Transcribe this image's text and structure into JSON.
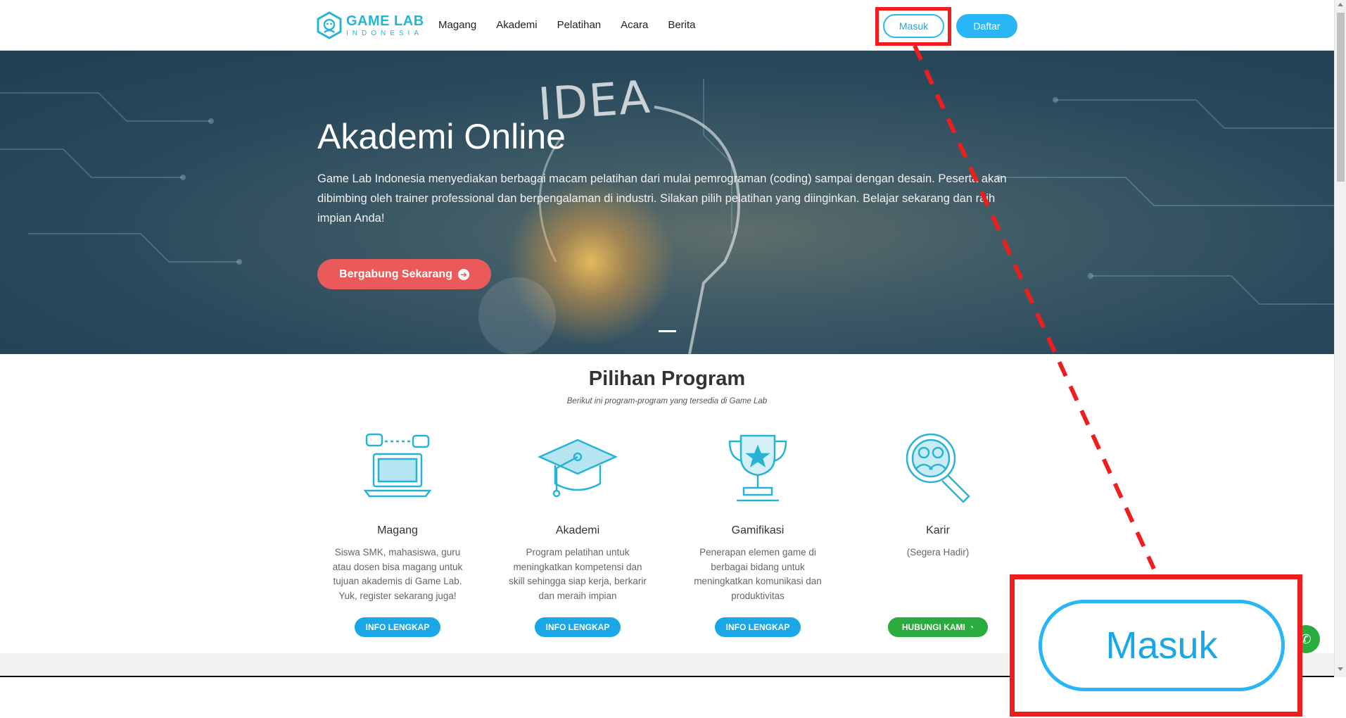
{
  "brand": {
    "name": "GAME LAB",
    "sub": "INDONESIA"
  },
  "nav": {
    "items": [
      "Magang",
      "Akademi",
      "Pelatihan",
      "Acara",
      "Berita"
    ],
    "login_label": "Masuk",
    "register_label": "Daftar"
  },
  "hero": {
    "title": "Akademi Online",
    "description": "Game Lab Indonesia menyediakan berbagai macam pelatihan dari mulai pemrograman (coding) sampai dengan desain. Peserta akan dibimbing oleh trainer professional dan berpengalaman di industri. Silakan pilih pelatihan yang diinginkan. Belajar sekarang dan raih impian Anda!",
    "cta_label": "Bergabung Sekarang",
    "background_text": "IDEA"
  },
  "programs": {
    "title": "Pilihan Program",
    "subtitle": "Berikut ini program-program yang tersedia di Game Lab",
    "cards": [
      {
        "title": "Magang",
        "desc": "Siswa SMK, mahasiswa, guru atau dosen bisa magang untuk tujuan akademis di Game Lab. Yuk, register sekarang juga!",
        "button": "INFO LENGKAP",
        "icon": "laptop-icon"
      },
      {
        "title": "Akademi",
        "desc": "Program pelatihan untuk meningkatkan kompetensi dan skill sehingga siap kerja, berkarir dan meraih impian",
        "button": "INFO LENGKAP",
        "icon": "graduation-cap-icon"
      },
      {
        "title": "Gamifikasi",
        "desc": "Penerapan elemen game di berbagai bidang untuk meningkatkan komunikasi dan produktivitas",
        "button": "INFO LENGKAP",
        "icon": "trophy-icon"
      },
      {
        "title": "Karir",
        "desc": "(Segera Hadir)",
        "button": "HUBUNGI KAMI",
        "icon": "magnifier-people-icon"
      }
    ]
  },
  "zoom": {
    "label": "Masuk"
  },
  "colors": {
    "accent": "#29b6f6",
    "cta": "#ea5a5a",
    "green": "#2aab3e",
    "highlight": "#ef1d1d",
    "brand": "#27b4d4"
  }
}
